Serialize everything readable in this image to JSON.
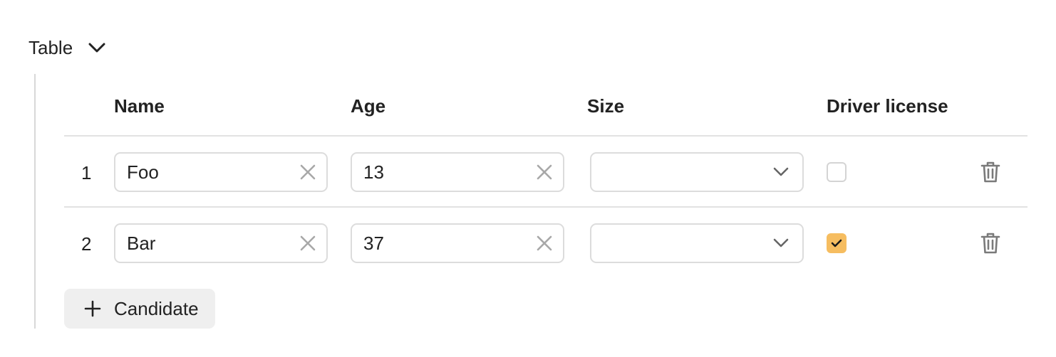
{
  "section": {
    "title": "Table",
    "toggle_icon": "chevron-down-icon"
  },
  "table": {
    "columns": [
      "Name",
      "Age",
      "Size",
      "Driver license"
    ],
    "rows": [
      {
        "index": "1",
        "name": "Foo",
        "age": "13",
        "size": "",
        "driver_license": false
      },
      {
        "index": "2",
        "name": "Bar",
        "age": "37",
        "size": "",
        "driver_license": true
      }
    ]
  },
  "add_button": {
    "label": "Candidate",
    "icon": "plus-icon"
  },
  "colors": {
    "checkbox_checked": "#f6bd60",
    "divider": "#e2e2e2",
    "input_border": "#dcdcdc",
    "button_bg": "#efefef"
  }
}
